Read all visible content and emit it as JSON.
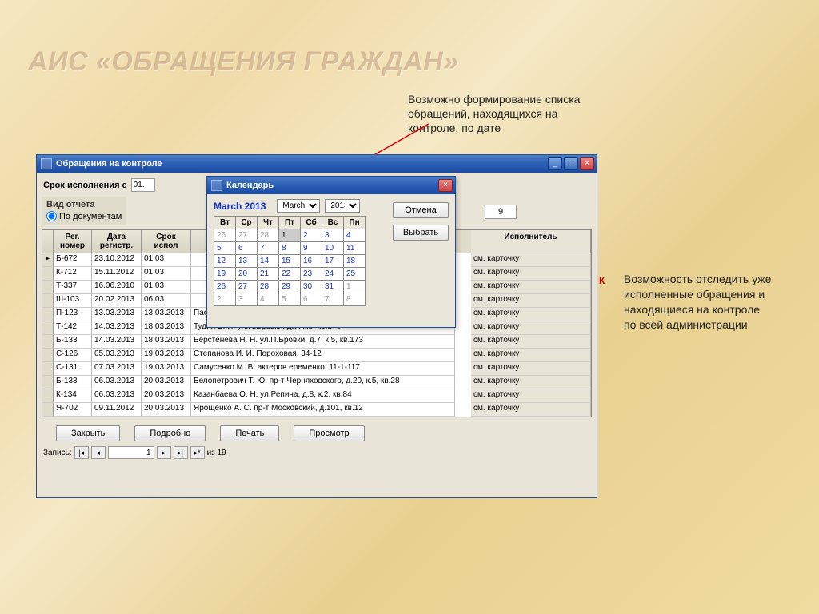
{
  "page_title": "АИС «ОБРАЩЕНИЯ ГРАЖДАН»",
  "annotation1": "Возможно формирование списка\nобращений, находящихся на\nконтроле, по дате",
  "annotation2": "Возможность отследить уже\nисполненные обращения и\nнаходящиеся на контроле\nпо всей администрации",
  "main_window": {
    "title": "Обращения на контроле",
    "filter_label": "Срок исполнения с",
    "filter_date1": "01.",
    "report_title": "Вид отчета",
    "report_option": "По документам",
    "count_box": "9",
    "headers": {
      "reg": "Рег.\nномер",
      "date": "Дата\nрегистр.",
      "srok": "Срок\nиспол",
      "desc": "",
      "isp": "Исполнитель"
    },
    "rows": [
      {
        "reg": "Б-672",
        "date": "23.10.2012",
        "srok": "01.03",
        "desc": "",
        "isp": "см. карточку"
      },
      {
        "reg": "К-712",
        "date": "15.11.2012",
        "srok": "01.03",
        "desc": "",
        "isp": "см. карточку"
      },
      {
        "reg": "Т-337",
        "date": "16.06.2010",
        "srok": "01.03",
        "desc": "",
        "isp": "см. карточку"
      },
      {
        "reg": "Ш-103",
        "date": "20.02.2013",
        "srok": "06.03",
        "desc": "",
        "isp": "см. карточку"
      },
      {
        "reg": "П-123",
        "date": "13.03.2013",
        "srok": "13.03.2013",
        "desc": "Пасевич Н. А. Короткевича 18-1-42",
        "isp": "см. карточку"
      },
      {
        "reg": "Т-142",
        "date": "14.03.2013",
        "srok": "18.03.2013",
        "desc": "Тудин В. И. ул.П.Бровки, д.7, к.5, кв.170",
        "isp": "см. карточку"
      },
      {
        "reg": "Б-133",
        "date": "14.03.2013",
        "srok": "18.03.2013",
        "desc": "Берстенева Н. Н. ул.П.Бровки, д.7, к.5, кв.173",
        "isp": "см. карточку"
      },
      {
        "reg": "С-126",
        "date": "05.03.2013",
        "srok": "19.03.2013",
        "desc": "Степанова И. И. Пороховая, 34-12",
        "isp": "см. карточку"
      },
      {
        "reg": "С-131",
        "date": "07.03.2013",
        "srok": "19.03.2013",
        "desc": "Самусенко М. В. актеров еременко, 11-1-117",
        "isp": "см. карточку"
      },
      {
        "reg": "Б-133",
        "date": "06.03.2013",
        "srok": "20.03.2013",
        "desc": "Белопетрович Т. Ю. пр-т Черняховского, д.20, к.5, кв.28",
        "isp": "см. карточку"
      },
      {
        "reg": "К-134",
        "date": "06.03.2013",
        "srok": "20.03.2013",
        "desc": "Казанбаева О. Н. ул.Репина, д.8, к.2, кв.84",
        "isp": "см. карточку"
      },
      {
        "reg": "Я-702",
        "date": "09.11.2012",
        "srok": "20.03.2013",
        "desc": "Ярощенко А. С. пр-т Московский, д.101, кв.12",
        "isp": "см. карточку"
      }
    ],
    "buttons": {
      "close": "Закрыть",
      "detail": "Подробно",
      "print": "Печать",
      "view": "Просмотр"
    },
    "record_nav": {
      "label": "Запись:",
      "pos": "1",
      "total": "из  19"
    }
  },
  "calendar": {
    "title": "Календарь",
    "month_label": "March 2013",
    "month_sel": "March",
    "year_sel": "2013",
    "btn_cancel": "Отмена",
    "btn_select": "Выбрать",
    "days": [
      "Вт",
      "Ср",
      "Чт",
      "Пт",
      "Сб",
      "Вс",
      "Пн"
    ],
    "weeks": [
      [
        {
          "v": "26",
          "g": true
        },
        {
          "v": "27",
          "g": true
        },
        {
          "v": "28",
          "g": true
        },
        {
          "v": "1",
          "sel": true
        },
        {
          "v": "2"
        },
        {
          "v": "3"
        },
        {
          "v": "4"
        }
      ],
      [
        {
          "v": "5"
        },
        {
          "v": "6"
        },
        {
          "v": "7"
        },
        {
          "v": "8"
        },
        {
          "v": "9"
        },
        {
          "v": "10"
        },
        {
          "v": "11"
        }
      ],
      [
        {
          "v": "12"
        },
        {
          "v": "13"
        },
        {
          "v": "14"
        },
        {
          "v": "15"
        },
        {
          "v": "16"
        },
        {
          "v": "17"
        },
        {
          "v": "18"
        }
      ],
      [
        {
          "v": "19"
        },
        {
          "v": "20"
        },
        {
          "v": "21"
        },
        {
          "v": "22"
        },
        {
          "v": "23"
        },
        {
          "v": "24"
        },
        {
          "v": "25"
        }
      ],
      [
        {
          "v": "26"
        },
        {
          "v": "27"
        },
        {
          "v": "28"
        },
        {
          "v": "29"
        },
        {
          "v": "30"
        },
        {
          "v": "31"
        },
        {
          "v": "1",
          "g": true
        }
      ],
      [
        {
          "v": "2",
          "g": true
        },
        {
          "v": "3",
          "g": true
        },
        {
          "v": "4",
          "g": true
        },
        {
          "v": "5",
          "g": true
        },
        {
          "v": "6",
          "g": true
        },
        {
          "v": "7",
          "g": true
        },
        {
          "v": "8",
          "g": true
        }
      ]
    ]
  },
  "marker": "К"
}
